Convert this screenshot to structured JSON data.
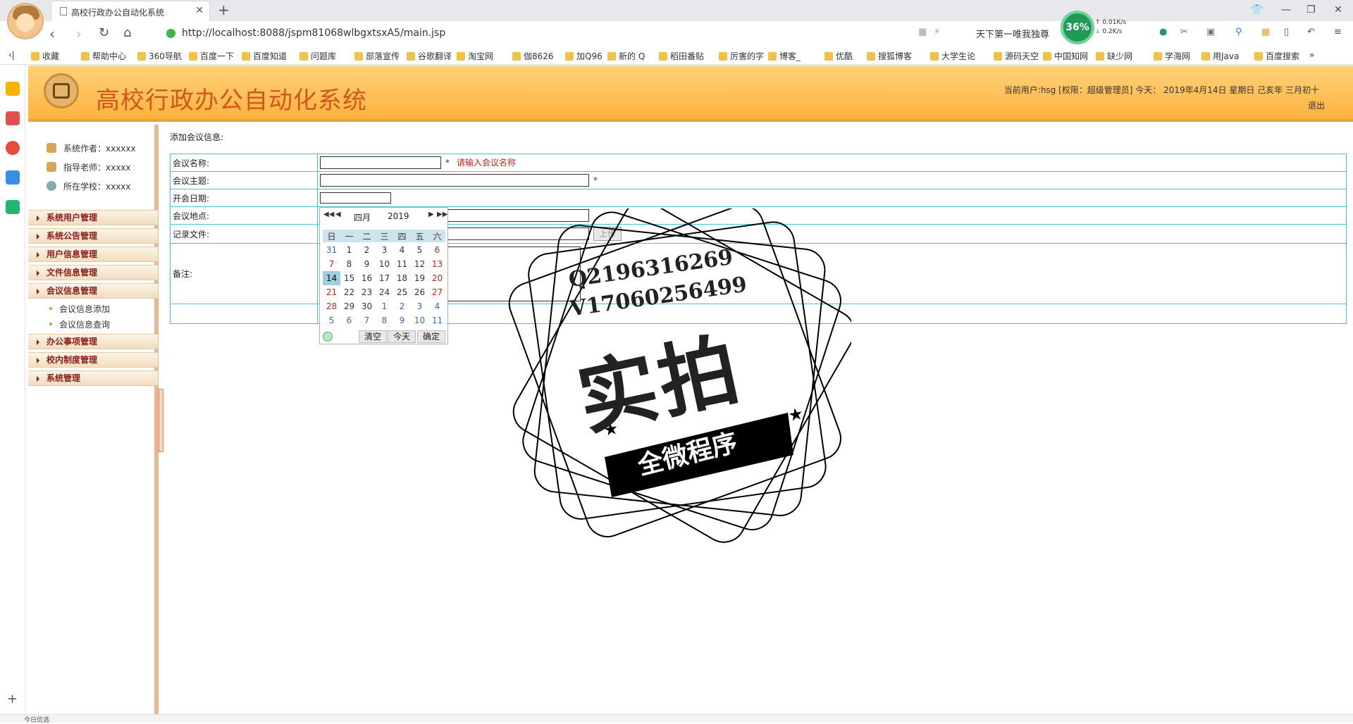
{
  "browser": {
    "tab_title": "高校行政办公自动化系统",
    "url": "http://localhost:8088/jspm81068wlbgxtsxA5/main.jsp",
    "search_text": "天下第一唯我独尊",
    "speed_percent": "36%",
    "upload_rate": "0.01K/s",
    "download_rate": "0.2K/s",
    "bookmarks": [
      "收藏",
      "帮助中心",
      "360导航",
      "百度一下",
      "百度知道",
      "问题库",
      "部落宣传",
      "谷歌翻译",
      "淘宝网",
      "伽8626",
      "加Q96",
      "新的 Q",
      "稻田番贴",
      "厉害的字",
      "博客_",
      "优酷",
      "搜狐博客",
      "大学生论",
      "源码天空",
      "中国知网",
      "缺少网",
      "学海网",
      "用Java",
      "百度搜索"
    ],
    "status_left": "今日优选"
  },
  "app": {
    "title": "高校行政办公自动化系统",
    "user_info": "当前用户:hsg [权限：超级管理员] 今天： 2019年4月14日 星期日 己亥年 三月初十",
    "logout": "退出"
  },
  "sidebar": {
    "info": [
      {
        "label": "系统作者：xxxxxx"
      },
      {
        "label": "指导老师：xxxxx"
      },
      {
        "label": "所在学校：xxxxx"
      }
    ],
    "menus": [
      "系统用户管理",
      "系统公告管理",
      "用户信息管理",
      "文件信息管理",
      "会议信息管理",
      "办公事项管理",
      "校内制度管理",
      "系统管理"
    ],
    "submenus": [
      "会议信息添加",
      "会议信息查询"
    ]
  },
  "form": {
    "heading": "添加会议信息:",
    "name_label": "会议名称:",
    "name_error": "请输入会议名称",
    "topic_label": "会议主题:",
    "date_label": "开会日期:",
    "place_label": "会议地点:",
    "file_label": "记录文件:",
    "upload_btn": "上传",
    "note_label": "备注:",
    "required": "*"
  },
  "calendar": {
    "month": "四月",
    "year": "2019",
    "weekdays": [
      "日",
      "一",
      "二",
      "三",
      "四",
      "五",
      "六"
    ],
    "weeks": [
      [
        "31",
        "1",
        "2",
        "3",
        "4",
        "5",
        "6"
      ],
      [
        "7",
        "8",
        "9",
        "10",
        "11",
        "12",
        "13"
      ],
      [
        "14",
        "15",
        "16",
        "17",
        "18",
        "19",
        "20"
      ],
      [
        "21",
        "22",
        "23",
        "24",
        "25",
        "26",
        "27"
      ],
      [
        "28",
        "29",
        "30",
        "1",
        "2",
        "3",
        "4"
      ],
      [
        "5",
        "6",
        "7",
        "8",
        "9",
        "10",
        "11"
      ]
    ],
    "selected": "14",
    "clear_btn": "清空",
    "today_btn": "今天",
    "ok_btn": "确定"
  },
  "watermark": {
    "line1": "Q2196316269",
    "line2": "V17060256499",
    "big": "实拍",
    "ribbon": "全微程序"
  }
}
